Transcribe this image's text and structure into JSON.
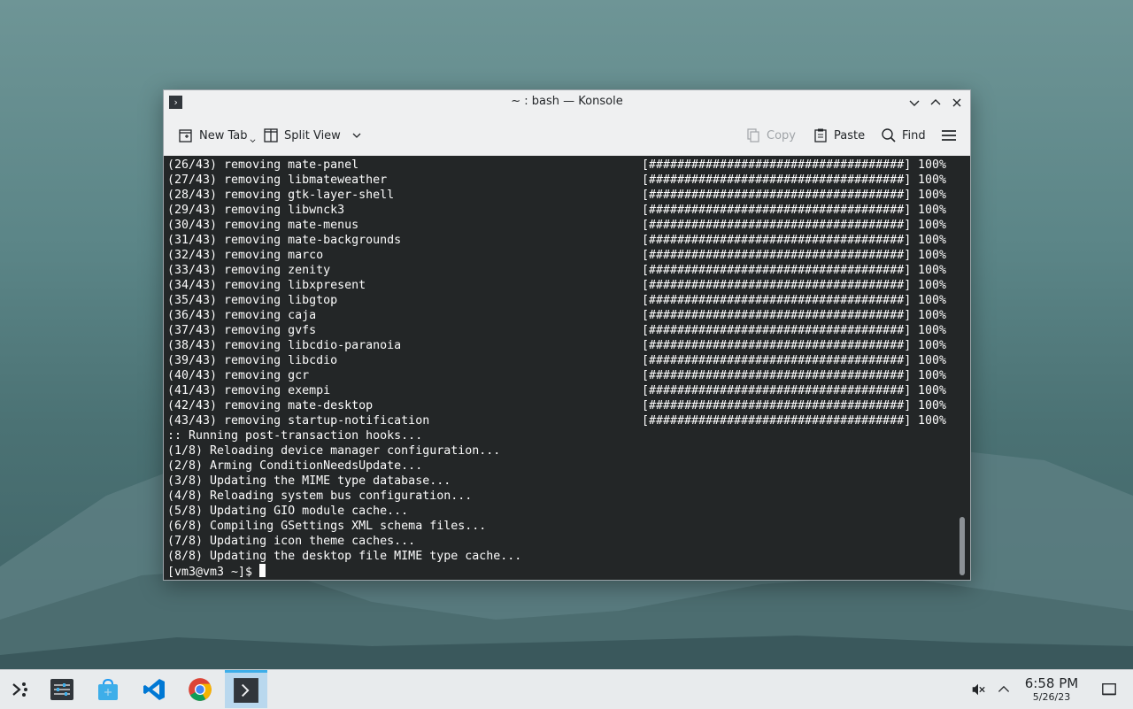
{
  "window": {
    "title": "~ : bash — Konsole"
  },
  "toolbar": {
    "new_tab": "New Tab",
    "split_view": "Split View",
    "copy": "Copy",
    "paste": "Paste",
    "find": "Find"
  },
  "terminal": {
    "remove_lines": [
      {
        "text": "(26/43) removing mate-panel",
        "bar": "[####################################]",
        "pct": "100%"
      },
      {
        "text": "(27/43) removing libmateweather",
        "bar": "[####################################]",
        "pct": "100%"
      },
      {
        "text": "(28/43) removing gtk-layer-shell",
        "bar": "[####################################]",
        "pct": "100%"
      },
      {
        "text": "(29/43) removing libwnck3",
        "bar": "[####################################]",
        "pct": "100%"
      },
      {
        "text": "(30/43) removing mate-menus",
        "bar": "[####################################]",
        "pct": "100%"
      },
      {
        "text": "(31/43) removing mate-backgrounds",
        "bar": "[####################################]",
        "pct": "100%"
      },
      {
        "text": "(32/43) removing marco",
        "bar": "[####################################]",
        "pct": "100%"
      },
      {
        "text": "(33/43) removing zenity",
        "bar": "[####################################]",
        "pct": "100%"
      },
      {
        "text": "(34/43) removing libxpresent",
        "bar": "[####################################]",
        "pct": "100%"
      },
      {
        "text": "(35/43) removing libgtop",
        "bar": "[####################################]",
        "pct": "100%"
      },
      {
        "text": "(36/43) removing caja",
        "bar": "[####################################]",
        "pct": "100%"
      },
      {
        "text": "(37/43) removing gvfs",
        "bar": "[####################################]",
        "pct": "100%"
      },
      {
        "text": "(38/43) removing libcdio-paranoia",
        "bar": "[####################################]",
        "pct": "100%"
      },
      {
        "text": "(39/43) removing libcdio",
        "bar": "[####################################]",
        "pct": "100%"
      },
      {
        "text": "(40/43) removing gcr",
        "bar": "[####################################]",
        "pct": "100%"
      },
      {
        "text": "(41/43) removing exempi",
        "bar": "[####################################]",
        "pct": "100%"
      },
      {
        "text": "(42/43) removing mate-desktop",
        "bar": "[####################################]",
        "pct": "100%"
      },
      {
        "text": "(43/43) removing startup-notification",
        "bar": "[####################################]",
        "pct": "100%"
      }
    ],
    "hook_lines": [
      ":: Running post-transaction hooks...",
      "(1/8) Reloading device manager configuration...",
      "(2/8) Arming ConditionNeedsUpdate...",
      "(3/8) Updating the MIME type database...",
      "(4/8) Reloading system bus configuration...",
      "(5/8) Updating GIO module cache...",
      "(6/8) Compiling GSettings XML schema files...",
      "(7/8) Updating icon theme caches...",
      "(8/8) Updating the desktop file MIME type cache..."
    ],
    "prompt": "[vm3@vm3 ~]$ "
  },
  "taskbar": {
    "apps": [
      "application-launcher-icon",
      "system-settings-icon",
      "discover-store-icon",
      "vscode-icon",
      "chrome-icon",
      "konsole-icon"
    ],
    "clock_time": "6:58 PM",
    "clock_date": "5/26/23"
  },
  "colors": {
    "terminal_bg": "#232627",
    "terminal_fg": "#fcfcfc",
    "accent": "#3daee9"
  }
}
